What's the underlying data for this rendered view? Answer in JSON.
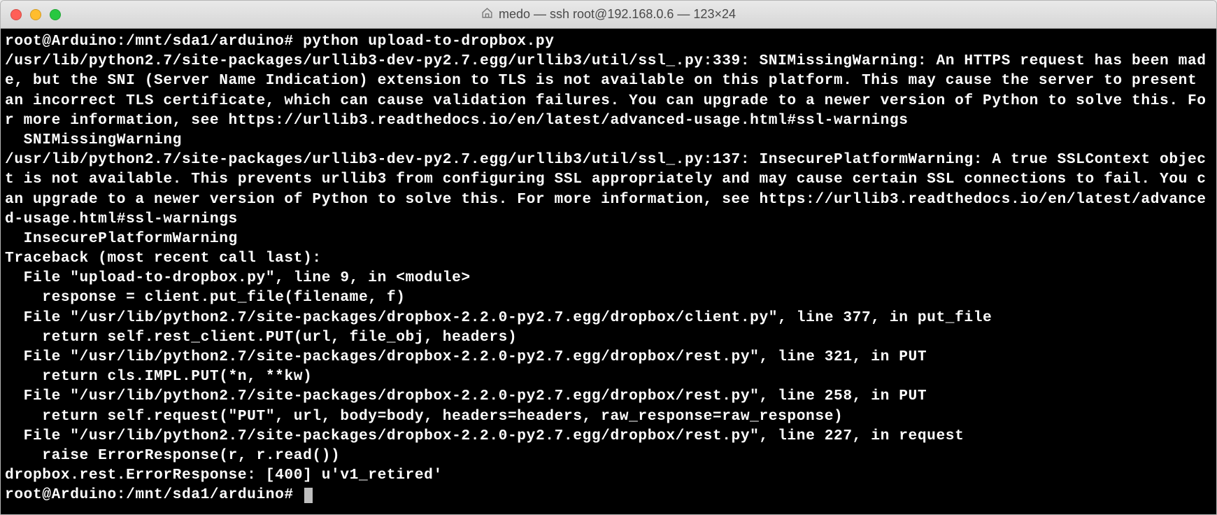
{
  "window": {
    "title": "medo — ssh root@192.168.0.6 — 123×24"
  },
  "terminal": {
    "lines": [
      "root@Arduino:/mnt/sda1/arduino# python upload-to-dropbox.py",
      "/usr/lib/python2.7/site-packages/urllib3-dev-py2.7.egg/urllib3/util/ssl_.py:339: SNIMissingWarning: An HTTPS request has been made, but the SNI (Server Name Indication) extension to TLS is not available on this platform. This may cause the server to present an incorrect TLS certificate, which can cause validation failures. You can upgrade to a newer version of Python to solve this. For more information, see https://urllib3.readthedocs.io/en/latest/advanced-usage.html#ssl-warnings",
      "  SNIMissingWarning",
      "/usr/lib/python2.7/site-packages/urllib3-dev-py2.7.egg/urllib3/util/ssl_.py:137: InsecurePlatformWarning: A true SSLContext object is not available. This prevents urllib3 from configuring SSL appropriately and may cause certain SSL connections to fail. You can upgrade to a newer version of Python to solve this. For more information, see https://urllib3.readthedocs.io/en/latest/advanced-usage.html#ssl-warnings",
      "  InsecurePlatformWarning",
      "Traceback (most recent call last):",
      "  File \"upload-to-dropbox.py\", line 9, in <module>",
      "    response = client.put_file(filename, f)",
      "  File \"/usr/lib/python2.7/site-packages/dropbox-2.2.0-py2.7.egg/dropbox/client.py\", line 377, in put_file",
      "    return self.rest_client.PUT(url, file_obj, headers)",
      "  File \"/usr/lib/python2.7/site-packages/dropbox-2.2.0-py2.7.egg/dropbox/rest.py\", line 321, in PUT",
      "    return cls.IMPL.PUT(*n, **kw)",
      "  File \"/usr/lib/python2.7/site-packages/dropbox-2.2.0-py2.7.egg/dropbox/rest.py\", line 258, in PUT",
      "    return self.request(\"PUT\", url, body=body, headers=headers, raw_response=raw_response)",
      "  File \"/usr/lib/python2.7/site-packages/dropbox-2.2.0-py2.7.egg/dropbox/rest.py\", line 227, in request",
      "    raise ErrorResponse(r, r.read())",
      "dropbox.rest.ErrorResponse: [400] u'v1_retired'"
    ],
    "prompt": "root@Arduino:/mnt/sda1/arduino# "
  }
}
